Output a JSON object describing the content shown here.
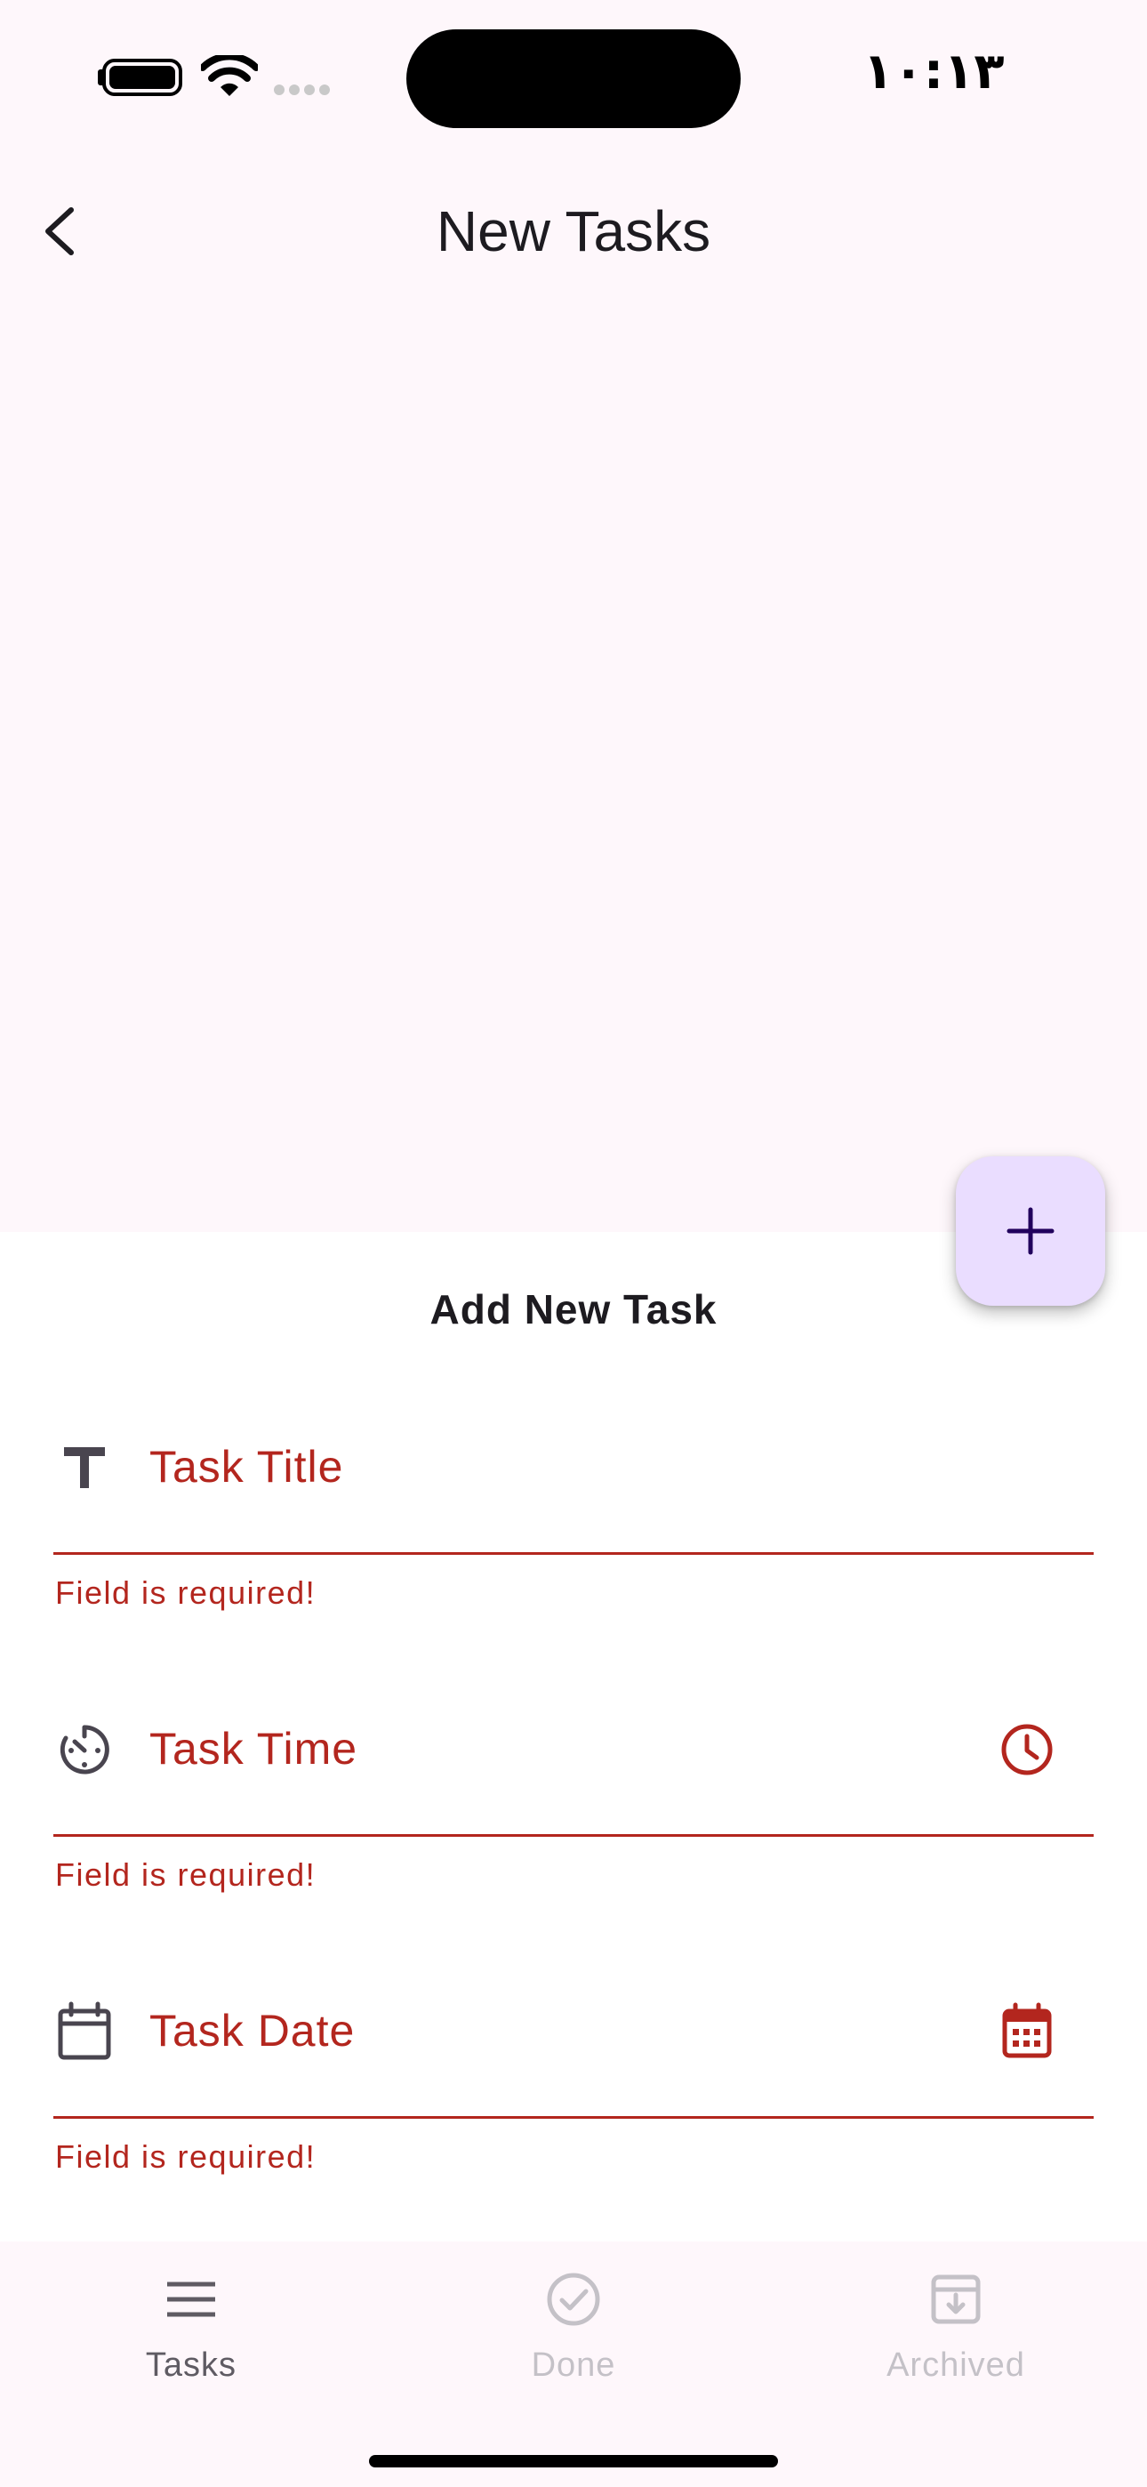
{
  "status_bar": {
    "time": "١٠:١٣"
  },
  "app_bar": {
    "title": "New Tasks",
    "back_icon": "chevron-left-icon"
  },
  "sheet": {
    "title": "Add New Task",
    "fields": [
      {
        "label": "Task Title",
        "lead_icon": "text-t-icon",
        "trail_icon": "",
        "error": "Field is required!"
      },
      {
        "label": "Task Time",
        "lead_icon": "timer-icon",
        "trail_icon": "clock-icon",
        "error": "Field is required!"
      },
      {
        "label": "Task Date",
        "lead_icon": "calendar-outline-icon",
        "trail_icon": "calendar-filled-icon",
        "error": "Field is required!"
      }
    ]
  },
  "fab": {
    "icon": "plus-icon"
  },
  "bottom_nav": {
    "items": [
      {
        "label": "Tasks",
        "icon": "menu-icon",
        "active": true
      },
      {
        "label": "Done",
        "icon": "check-circle-icon",
        "active": false
      },
      {
        "label": "Archived",
        "icon": "archive-icon",
        "active": false
      }
    ]
  },
  "colors": {
    "background": "#fef7fb",
    "sheet": "#ffffff",
    "error": "#b3261e",
    "fab": "#eaddff",
    "fab_icon": "#21005d",
    "inactive": "#c4c1c7",
    "active": "#5f5b63"
  }
}
